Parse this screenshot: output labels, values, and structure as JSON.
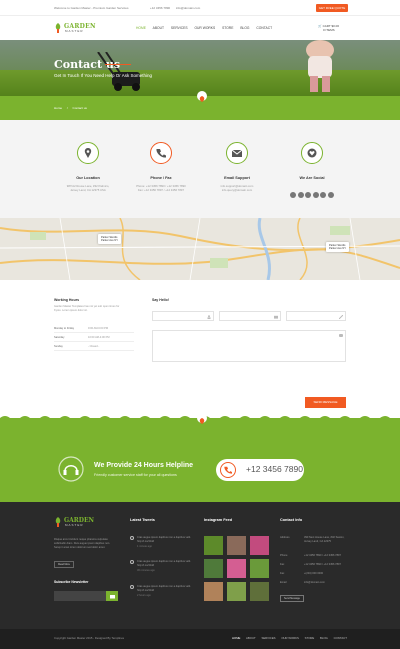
{
  "topbar": {
    "welcome": "Welcome to Garden Master - Premium Garden Services",
    "phone": "+12 3456 7890",
    "email": "info@domain.com",
    "quote_button": "GET FREE QUOTE"
  },
  "brand": {
    "name": "GARDEN",
    "sub": "MASTER",
    "accent": "#7bb32e",
    "orange": "#f15a22"
  },
  "nav": [
    "HOME",
    "ABOUT",
    "SERVICES",
    "OUR WORKS",
    "STORE",
    "BLOG",
    "CONTACT"
  ],
  "cart": {
    "label": "CART",
    "amount": "$0.00",
    "items": "0 ITEMS"
  },
  "hero": {
    "title": "Contact us",
    "subtitle": "Get In Touch If You Need Help Or Ask Something"
  },
  "breadcrumb": {
    "home": "Home",
    "current": "Contact us"
  },
  "cards": [
    {
      "icon": "location-pin-icon",
      "title": "Our Location",
      "lines": [
        "987/A2 Rouse Lane, #32 Palmico,",
        "Jersey Land, CA 12375 USA"
      ]
    },
    {
      "icon": "phone-icon",
      "title": "Phone / Fax",
      "lines": [
        "Phone: +12 3456 7890 / +12 3456 7890",
        "Fax: +12 3456 7897 / +12 3456 7897"
      ]
    },
    {
      "icon": "email-icon",
      "title": "Email Support",
      "lines": [
        "info.support@domain.com",
        "info.query@domain.com"
      ]
    },
    {
      "icon": "heart-icon",
      "title": "We Are Social",
      "lines": []
    }
  ],
  "map": {
    "pin1": {
      "name": "Parker Skords",
      "address": "Parker Ave NY"
    },
    "pin2": {
      "name": "Parker Skords",
      "address": "Parker Ave NY"
    }
  },
  "working_hours": {
    "title": "Working Hours",
    "description": "Garden Master Templates has not yet sub open times for Kyoto. Lorem ipsum dolor sit.",
    "rows": [
      {
        "day": "Monday to Friday",
        "time": "9:00 AM-6:00 PM"
      },
      {
        "day": "Saturday",
        "time": "10:00 AM-4:00 PM"
      },
      {
        "day": "Sunday",
        "time": "- Closed -"
      }
    ]
  },
  "form": {
    "title": "Say Hello!",
    "send_label": "SEND MESSAGE"
  },
  "helpline": {
    "title": "We Provide 24 Hours Helpline",
    "subtitle": "Friendly customer service staff for your all questions",
    "phone": "+12 3456 7890"
  },
  "footer": {
    "about": "Risque arcu tincidunt neque pharetra vulputate sollicitudin diam. Duis augue ipsum dapibus non. Setup it amet lorem dolorum sed dolor amet.",
    "read_more": "Read More",
    "newsletter_title": "Subscribe Newsletter",
    "tweets_title": "Latest Tweets",
    "tweets": [
      {
        "text": "Cras augue ipsum dapibus non a dapibus velit. http://t.co/4Jdd",
        "ago": "1 minute ago"
      },
      {
        "text": "Cras augue ipsum dapibus non a dapibus velit. http://t.co/4Jdd",
        "ago": "30 minutes ago"
      },
      {
        "text": "Cras augue ipsum dapibus non a dapibus velit. http://t.co/4Jdd",
        "ago": "2 hours ago"
      }
    ],
    "instagram_title": "Instagram Feed",
    "contact_title": "Contact Info",
    "contact": [
      {
        "key": "Address",
        "value": "390 Next House Lane, #32 Saxton, Jersey Land, CA 12375"
      },
      {
        "key": "Phone",
        "value": "+12 3456 7890 / +12 3456 7897"
      },
      {
        "key": "Fax",
        "value": "+12 3456 7890 / +12 3456 7897"
      },
      {
        "key": "Fax",
        "value": "+(234) 000 0000"
      },
      {
        "key": "Email",
        "value": "info@domain.com"
      }
    ],
    "send_message": "Send Message"
  },
  "bottom": {
    "copyright": "Copyright Garden Master 2015 - Designed By Templines",
    "nav": [
      "HOME",
      "ABOUT",
      "SERVICES",
      "OUR WORKS",
      "STORE",
      "BLOG",
      "CONTACT"
    ]
  }
}
